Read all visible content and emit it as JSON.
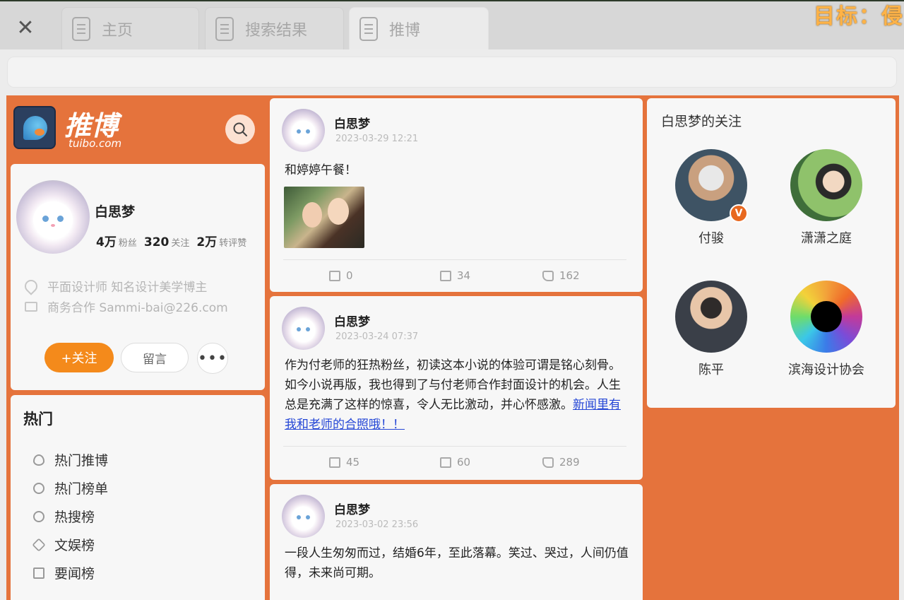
{
  "browser": {
    "tabs": [
      {
        "label": "主页"
      },
      {
        "label": "搜索结果"
      },
      {
        "label": "推博"
      }
    ],
    "overlay_target": "目标：侵"
  },
  "brand": {
    "name": "推博",
    "domain": "tuibo.com"
  },
  "profile": {
    "name": "白思梦",
    "fans": {
      "value": "4万",
      "unit": "粉丝"
    },
    "following": {
      "value": "320",
      "unit": "关注"
    },
    "reposts": {
      "value": "2万",
      "unit": "转评赞"
    },
    "bio": "平面设计师 知名设计美学博主",
    "contact": "商务合作 Sammi-bai@226.com",
    "follow_label": "+关注",
    "message_label": "留言",
    "more_label": "•••"
  },
  "hot": {
    "title": "热门",
    "items": [
      {
        "label": "热门推博"
      },
      {
        "label": "热门榜单"
      },
      {
        "label": "热搜榜"
      },
      {
        "label": "文娱榜"
      },
      {
        "label": "要闻榜"
      }
    ]
  },
  "posts": [
    {
      "author": "白思梦",
      "date": "2023-03-29  12:21",
      "text": "和婷婷午餐！",
      "link": "",
      "reposts": "0",
      "comments": "34",
      "likes": "162"
    },
    {
      "author": "白思梦",
      "date": "2023-03-24  07:37",
      "text": "作为付老师的狂热粉丝，初读这本小说的体验可谓是铭心刻骨。如今小说再版，我也得到了与付老师合作封面设计的机会。人生总是充满了这样的惊喜，令人无比激动，并心怀感激。",
      "link": "新闻里有我和老师的合照哦！！",
      "reposts": "45",
      "comments": "60",
      "likes": "289"
    },
    {
      "author": "白思梦",
      "date": "2023-03-02  23:56",
      "text": "一段人生匆匆而过，结婚6年，至此落幕。笑过、哭过，人间仍值得，未来尚可期。",
      "link": ""
    }
  ],
  "follows": {
    "title": "白思梦的关注",
    "users": [
      {
        "name": "付骏",
        "badge": "V"
      },
      {
        "name": "潇潇之庭"
      },
      {
        "name": "陈平"
      },
      {
        "name": "滨海设计协会"
      }
    ]
  },
  "colors": {
    "brand_orange": "#e5733c",
    "follow_button": "#f48a1b",
    "link_blue": "#2446d6",
    "verified_badge": "#e8681f"
  }
}
